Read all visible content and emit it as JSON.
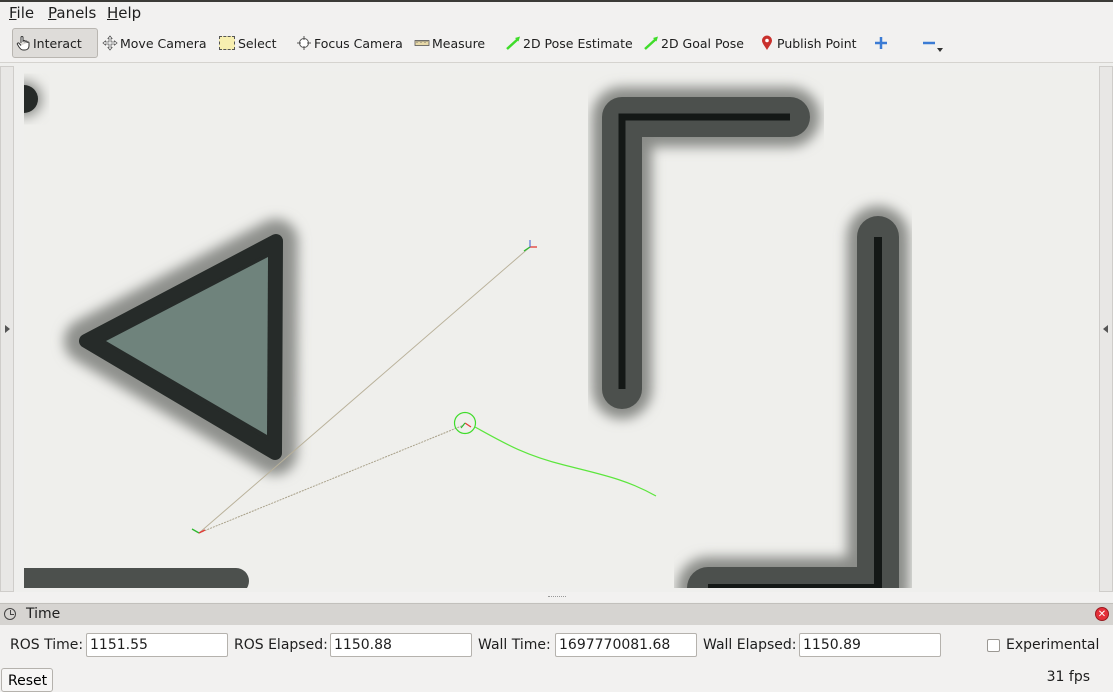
{
  "menu": {
    "file": {
      "accel": "F",
      "rest": "ile"
    },
    "panels": {
      "accel": "P",
      "rest": "anels"
    },
    "help": {
      "accel": "H",
      "rest": "elp"
    }
  },
  "toolbar": {
    "interact": "Interact",
    "move_camera": "Move Camera",
    "select": "Select",
    "focus_camera": "Focus Camera",
    "measure": "Measure",
    "pose_estimate": "2D Pose Estimate",
    "goal_pose": "2D Goal Pose",
    "publish_point": "Publish Point"
  },
  "colors": {
    "accent_green": "#3fdc2a",
    "obstacle_fill": "#6f837c",
    "publish_point_red": "#c9302c",
    "add_tool_blue": "#3b7bd4"
  },
  "time_panel": {
    "title": "Time",
    "ros_time_label": "ROS Time:",
    "ros_time_value": "1151.55",
    "ros_elapsed_label": "ROS Elapsed:",
    "ros_elapsed_value": "1150.88",
    "wall_time_label": "Wall Time:",
    "wall_time_value": "1697770081.68",
    "wall_elapsed_label": "Wall Elapsed:",
    "wall_elapsed_value": "1150.89",
    "experimental_label": "Experimental",
    "experimental_checked": false,
    "reset_label": "Reset",
    "fps": "31 fps"
  }
}
